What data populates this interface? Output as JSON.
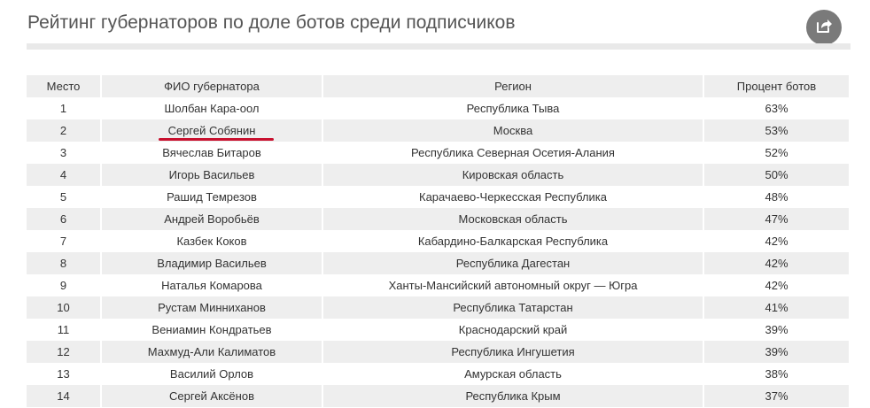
{
  "header": {
    "title": "Рейтинг губернаторов по доле ботов среди подписчиков",
    "share_icon": "share-icon"
  },
  "table": {
    "columns": [
      "Место",
      "ФИО губернатора",
      "Регион",
      "Процент ботов"
    ],
    "highlighted_row": 1,
    "highlight_color": "#c8102e",
    "rows": [
      {
        "place": "1",
        "name": "Шолбан Кара-оол",
        "region": "Республика Тыва",
        "percent": "63%"
      },
      {
        "place": "2",
        "name": "Сергей Собянин",
        "region": "Москва",
        "percent": "53%"
      },
      {
        "place": "3",
        "name": "Вячеслав Битаров",
        "region": "Республика Северная Осетия-Алания",
        "percent": "52%"
      },
      {
        "place": "4",
        "name": "Игорь Васильев",
        "region": "Кировская область",
        "percent": "50%"
      },
      {
        "place": "5",
        "name": "Рашид Темрезов",
        "region": "Карачаево-Черкесская Республика",
        "percent": "48%"
      },
      {
        "place": "6",
        "name": "Андрей Воробьёв",
        "region": "Московская область",
        "percent": "47%"
      },
      {
        "place": "7",
        "name": "Казбек Коков",
        "region": "Кабардино-Балкарская Республика",
        "percent": "42%"
      },
      {
        "place": "8",
        "name": "Владимир Васильев",
        "region": "Республика Дагестан",
        "percent": "42%"
      },
      {
        "place": "9",
        "name": "Наталья Комарова",
        "region": "Ханты-Мансийский автономный округ — Югра",
        "percent": "42%"
      },
      {
        "place": "10",
        "name": "Рустам Минниханов",
        "region": "Республика Татарстан",
        "percent": "41%"
      },
      {
        "place": "11",
        "name": "Вениамин Кондратьев",
        "region": "Краснодарский край",
        "percent": "39%"
      },
      {
        "place": "12",
        "name": "Махмуд-Али Калиматов",
        "region": "Республика Ингушетия",
        "percent": "39%"
      },
      {
        "place": "13",
        "name": "Василий Орлов",
        "region": "Амурская область",
        "percent": "38%"
      },
      {
        "place": "14",
        "name": "Сергей Аксёнов",
        "region": "Республика Крым",
        "percent": "37%"
      }
    ]
  }
}
